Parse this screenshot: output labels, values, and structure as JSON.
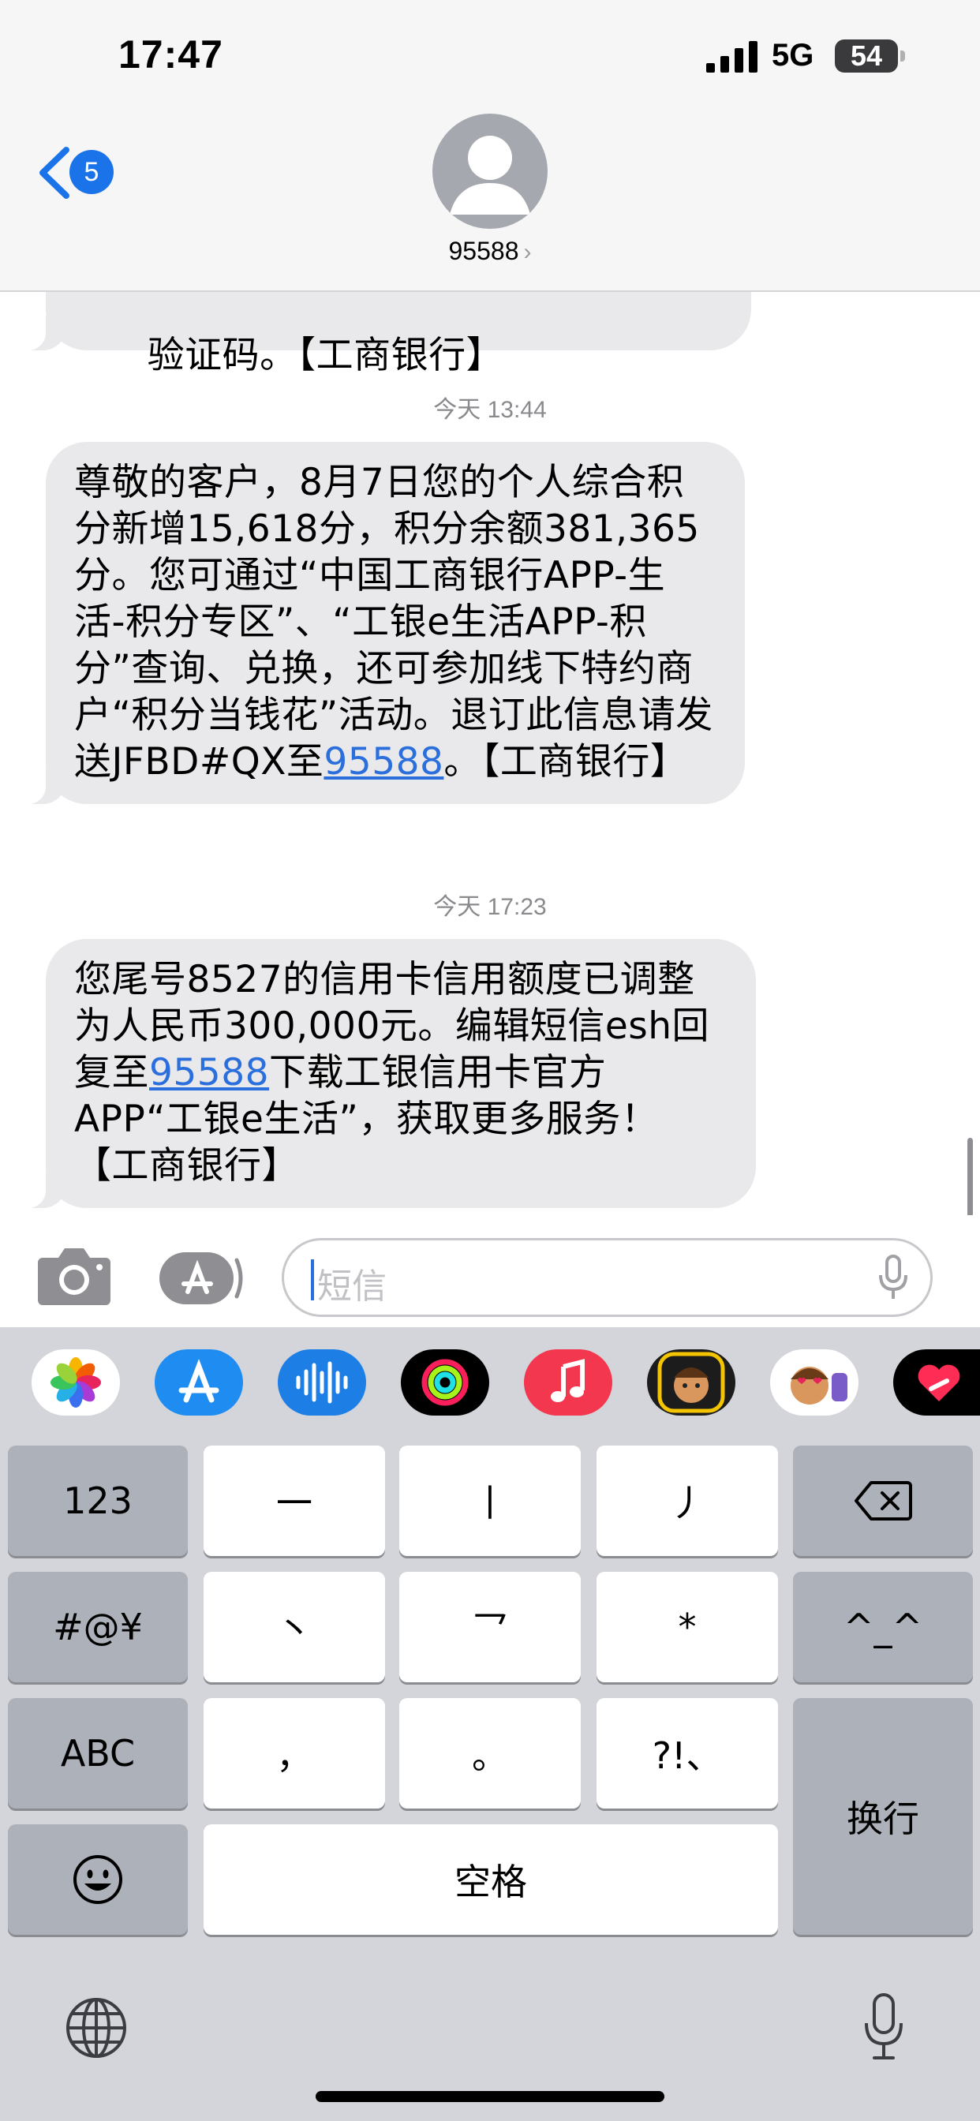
{
  "status_bar": {
    "time": "17:47",
    "network": "5G",
    "battery": "54"
  },
  "header": {
    "back_badge": "5",
    "contact": "95588",
    "contact_chevron": "›"
  },
  "messages": {
    "partial_text": "验证码。【工商银行】",
    "ts1": "今天 13:44",
    "m1_before": "尊敬的客户，8月7日您的个人综合积分新增15,618分，积分余额381,365分。您可通过“中国工商银行APP-生活-积分专区”、“工银e生活APP-积分”查询、兑换，还可参加线下特约商户“积分当钱花”活动。退订此信息请发送JFBD#QX至",
    "m1_link": "95588",
    "m1_after": "。【工商银行】",
    "ts2": "今天 17:23",
    "m2_before": "您尾号8527的信用卡信用额度已调整为人民币300,000元。编辑短信esh回复至",
    "m2_link": "95588",
    "m2_after": "下载工银信用卡官方APP“工银e生活”，获取更多服务！【工商银行】"
  },
  "compose": {
    "placeholder": "短信"
  },
  "app_strip": [
    "photos-icon",
    "app-store-icon",
    "audio-message-icon",
    "fitness-icon",
    "music-icon",
    "memoji-icon",
    "memoji-stickers-icon",
    "digital-touch-icon"
  ],
  "keyboard": {
    "k_123": "123",
    "k_heng": "一",
    "k_shu": "丨",
    "k_pie": "丿",
    "k_sym": "#@¥",
    "k_dian": "丶",
    "k_zhe": "乛",
    "k_star": "*",
    "k_emoticon": "^_^",
    "k_abc": "ABC",
    "k_comma": "，",
    "k_period": "。",
    "k_punct": "?!、",
    "k_return": "换行",
    "k_space": "空格"
  },
  "colors": {
    "bubble": "#e9e9eb",
    "link": "#2a6fdb",
    "accent": "#1a73e8",
    "keyboard_bg": "#d3d5da"
  }
}
